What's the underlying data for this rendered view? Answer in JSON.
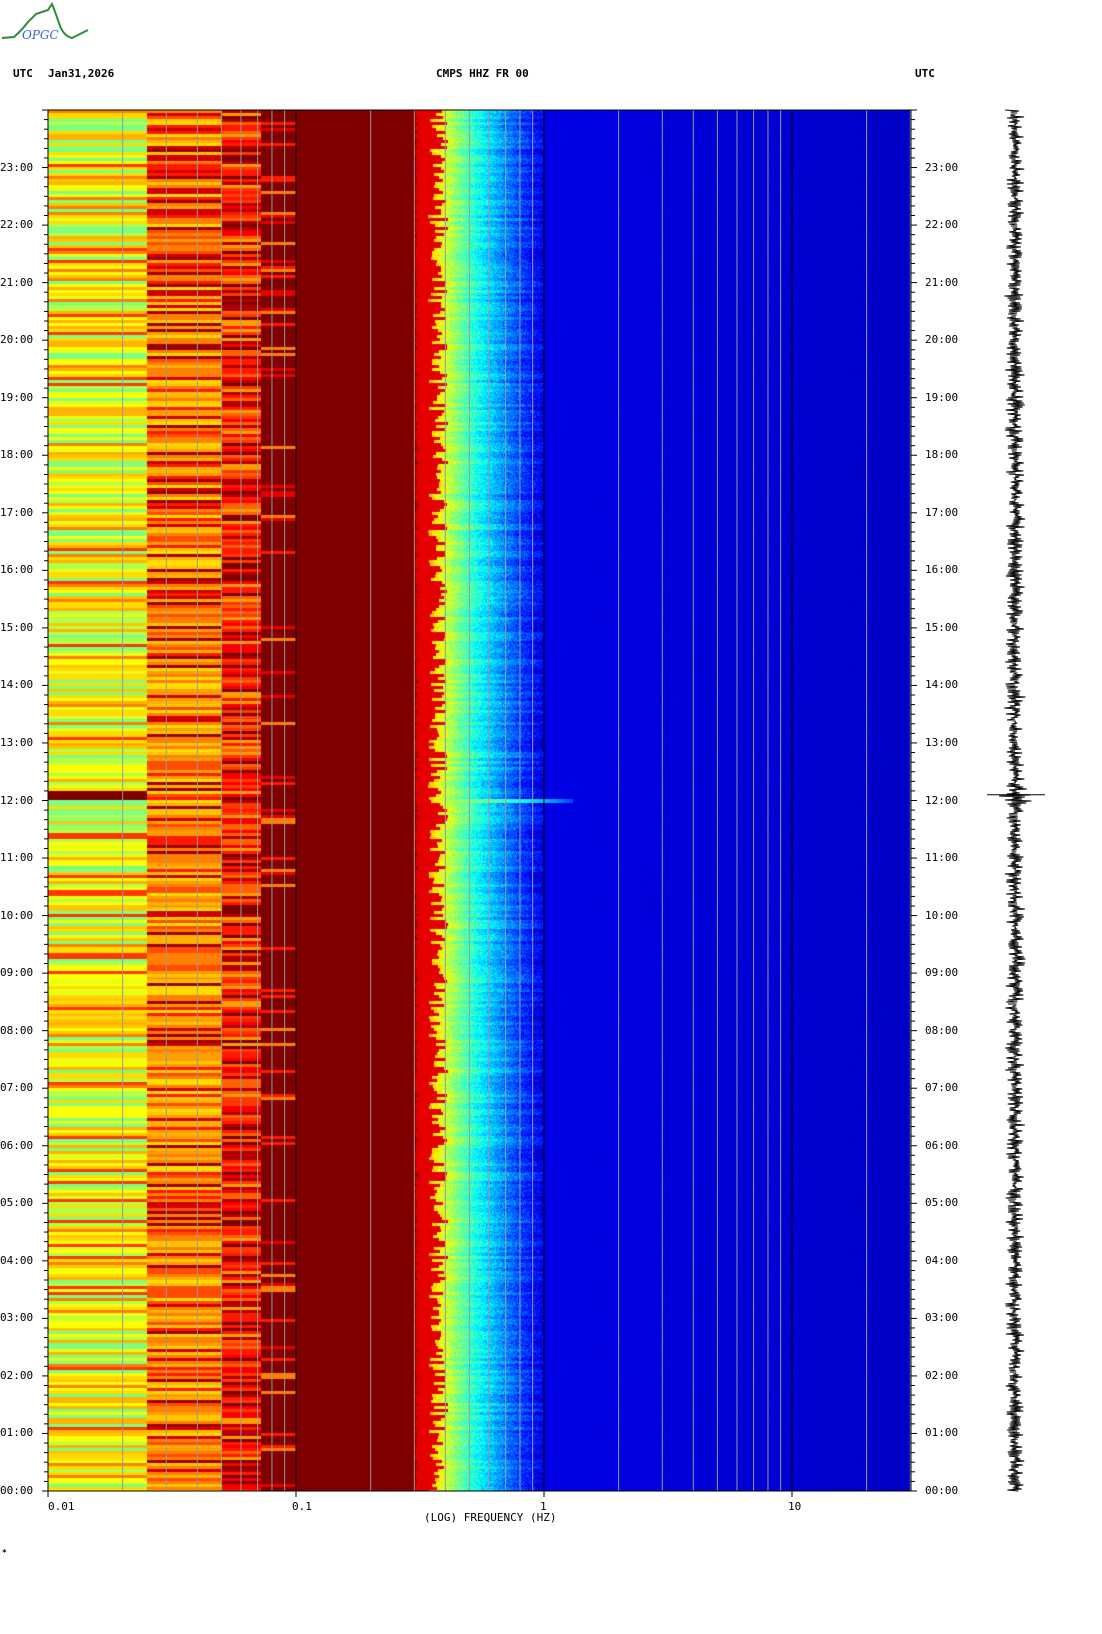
{
  "header": {
    "left_tz": "UTC",
    "date": "Jan31,2026",
    "station": "CMPS HHZ FR 00",
    "right_tz": "UTC",
    "logo_text": "OPGC"
  },
  "footer_mark": "*",
  "chart_data": {
    "type": "heatmap",
    "title": "CMPS HHZ FR 00",
    "xlabel": "(LOG) FREQUENCY (HZ)",
    "ylabel": "UTC",
    "xscale": "log",
    "xlim": [
      0.01,
      30
    ],
    "ylim_hours": [
      0,
      24
    ],
    "x_ticks": [
      "0.01",
      "0.1",
      "1",
      "10"
    ],
    "x_tick_values": [
      0.01,
      0.1,
      1,
      10
    ],
    "y_ticks": [
      "00:00",
      "01:00",
      "02:00",
      "03:00",
      "04:00",
      "05:00",
      "06:00",
      "07:00",
      "08:00",
      "09:00",
      "10:00",
      "11:00",
      "12:00",
      "13:00",
      "14:00",
      "15:00",
      "16:00",
      "17:00",
      "18:00",
      "19:00",
      "20:00",
      "21:00",
      "22:00",
      "23:00"
    ],
    "colormap": "jet",
    "bands": [
      {
        "f_from": 0.01,
        "f_to": 0.025,
        "level": "green-yellow"
      },
      {
        "f_from": 0.025,
        "f_to": 0.05,
        "level": "orange-red"
      },
      {
        "f_from": 0.05,
        "f_to": 0.072,
        "level": "red"
      },
      {
        "f_from": 0.072,
        "f_to": 0.3,
        "level": "dark red (saturated)"
      },
      {
        "f_from": 0.3,
        "f_to": 0.6,
        "level": "red to cyan transition"
      },
      {
        "f_from": 0.6,
        "f_to": 1.0,
        "level": "blue"
      },
      {
        "f_from": 1.0,
        "f_to": 30,
        "level": "dark blue"
      }
    ],
    "event": {
      "time": "12:00",
      "f_max": 1.1
    },
    "trace": {
      "event_time_hours": 12.1
    }
  }
}
